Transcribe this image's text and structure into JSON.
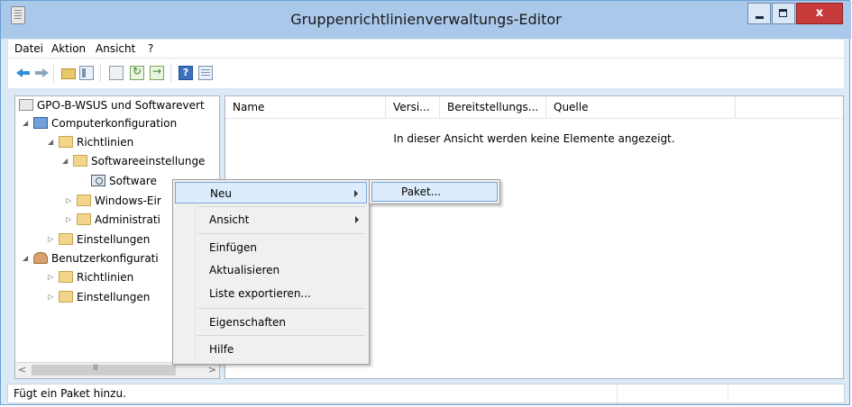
{
  "window": {
    "title": "Gruppenrichtlinienverwaltungs-Editor",
    "close_glyph": "x"
  },
  "menubar": [
    "Datei",
    "Aktion",
    "Ansicht",
    "?"
  ],
  "toolbar": {
    "icons": [
      "back-arrow-icon",
      "forward-arrow-icon",
      "folder-up-icon",
      "show-hide-tree-icon",
      "properties-icon",
      "refresh-icon",
      "export-list-icon",
      "help-icon",
      "view-icon"
    ],
    "help_glyph": "?"
  },
  "tree": {
    "root": "GPO-B-WSUS und Softwarevert",
    "computer": "Computerkonfiguration",
    "policies": "Richtlinien",
    "software_settings": "Softwareeinstellunge",
    "software_install": "Software",
    "windows_settings": "Windows-Eir",
    "admin_templates": "Administrati",
    "preferences": "Einstellungen",
    "user": "Benutzerkonfigurati",
    "user_policies": "Richtlinien",
    "user_preferences": "Einstellungen"
  },
  "list": {
    "columns": [
      "Name",
      "Versi...",
      "Bereitstellungs...",
      "Quelle"
    ],
    "empty_message": "In dieser Ansicht werden keine Elemente angezeigt."
  },
  "context_menu": {
    "items": [
      "Neu",
      "Ansicht",
      "Einfügen",
      "Aktualisieren",
      "Liste exportieren...",
      "Eigenschaften",
      "Hilfe"
    ]
  },
  "submenu": {
    "items": [
      "Paket..."
    ]
  },
  "statusbar": {
    "text": "Fügt ein Paket hinzu."
  }
}
